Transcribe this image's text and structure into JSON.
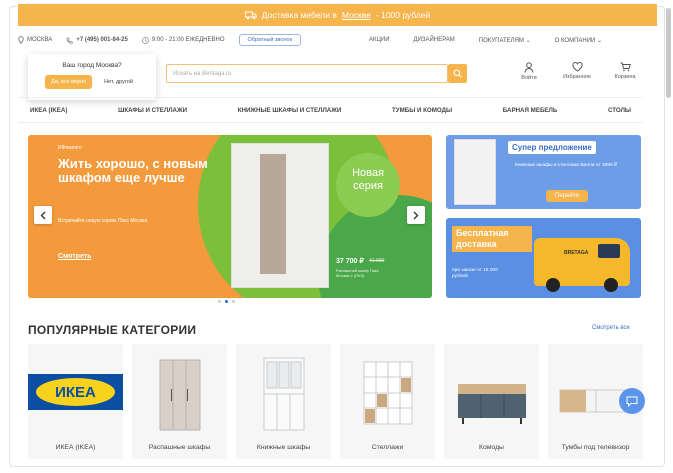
{
  "promo": {
    "prefix": "Доставка мебели в",
    "city": "Москве",
    "suffix": "- 1000 рублей"
  },
  "infobar": {
    "city": "МОСКВА",
    "phone": "+7 (495) 001-84-25",
    "hours": "9:00 - 21:00 ЕЖЕДНЕВНО",
    "callback": "Обратный звонок",
    "links": [
      "АКЦИИ",
      "ДИЗАЙНЕРАМ",
      "ПОКУПАТЕЛЯМ",
      "О КОМПАНИИ"
    ]
  },
  "city_popup": {
    "question": "Ваш город Москва?",
    "yes": "Да, все верно",
    "no": "Нет, другой"
  },
  "search": {
    "placeholder": "Искать на Bentaga.ru"
  },
  "header_icons": [
    "Войти",
    "Избранное",
    "Корзина"
  ],
  "catnav": [
    "ИКЕА (IKEA)",
    "ШКАФЫ И СТЕЛЛАЖИ",
    "КНИЖНЫЕ ШКАФЫ И СТЕЛЛАЖИ",
    "ТУМБЫ И КОМОДЫ",
    "БАРНАЯ МЕБЕЛЬ",
    "СТОЛЫ"
  ],
  "hero": {
    "brand": "ИФжилого",
    "title": "Жить хорошо, с новым шкафом еще лучше",
    "subtitle": "Встречайте новую серию Пакс Москва",
    "more": "Смотреть",
    "badge": "Новая серия",
    "price": "37 700 ₽",
    "old_price": "41 000",
    "price_note": "Распашной шкаф Пакс Москва 1 (ПКЗ)"
  },
  "banner1": {
    "title": "Супер предложение",
    "text": "Книжные шкафы и стеллажи Билли от 3999 ₽",
    "button": "Перейти"
  },
  "banner2": {
    "title": "Бесплатная доставка",
    "text": "при заказе от 15 000 рублей",
    "van_logo": "BRETAGA"
  },
  "popular": {
    "title": "ПОПУЛЯРНЫЕ КАТЕГОРИИ",
    "see_all": "Смотреть все",
    "ikea_logo": "ИКЕА",
    "cards": [
      "ИКЕА (IKEA)",
      "Распашные шкафы",
      "Книжные шкафы",
      "Стеллажи",
      "Комоды",
      "Тумбы под телевизор"
    ]
  },
  "colors": {
    "accent": "#f6b44c",
    "link": "#3b6fc4",
    "hero_bg": "#f39a3d"
  }
}
